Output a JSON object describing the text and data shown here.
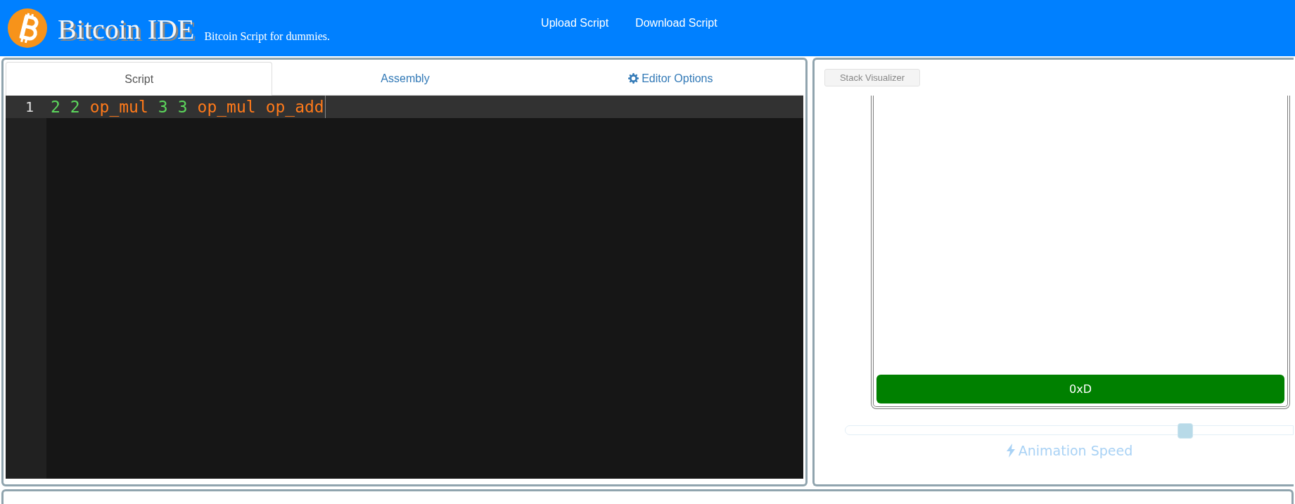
{
  "header": {
    "title": "Bitcoin IDE",
    "subtitle": "Bitcoin Script for dummies.",
    "nav": [
      "Upload Script",
      "Download Script"
    ]
  },
  "tabs": [
    {
      "label": "Script",
      "selected": true,
      "kind": "plain"
    },
    {
      "label": "Assembly",
      "selected": false,
      "kind": "plain"
    },
    {
      "label": "Editor Options",
      "selected": false,
      "kind": "options"
    }
  ],
  "editor": {
    "lines": [
      {
        "number": "1",
        "tokens": [
          {
            "text": "2",
            "kind": "number"
          },
          {
            "text": "2",
            "kind": "number"
          },
          {
            "text": "op_mul",
            "kind": "opcode"
          },
          {
            "text": "3",
            "kind": "number"
          },
          {
            "text": "3",
            "kind": "number"
          },
          {
            "text": "op_mul",
            "kind": "opcode"
          },
          {
            "text": "op_add",
            "kind": "opcode"
          }
        ]
      }
    ]
  },
  "stack_panel": {
    "button": "Stack Visualizer",
    "stack_items": [
      "0xD"
    ],
    "speed": {
      "level": 0.76,
      "label": "Animation Speed"
    }
  }
}
